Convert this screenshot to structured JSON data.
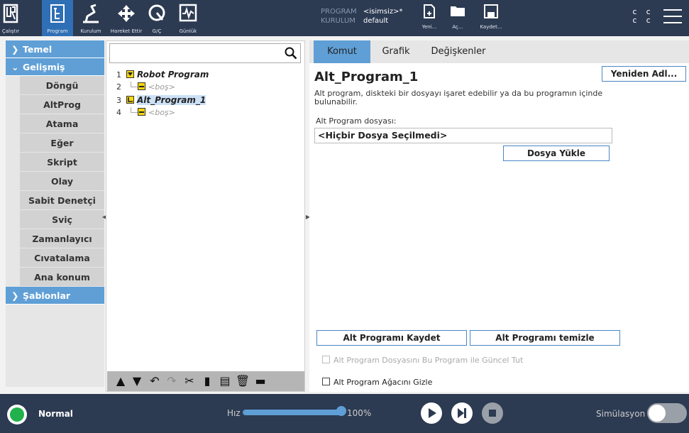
{
  "header": {
    "nav": [
      {
        "key": "run",
        "label": "Çalıştır",
        "icon": "ur-logo-icon"
      },
      {
        "key": "program",
        "label": "Program",
        "icon": "program-icon",
        "active": true
      },
      {
        "key": "installation",
        "label": "Kurulum",
        "icon": "installation-icon"
      },
      {
        "key": "move",
        "label": "Hareket Ettir",
        "icon": "move-icon"
      },
      {
        "key": "io",
        "label": "G/Ç",
        "icon": "io-icon"
      },
      {
        "key": "log",
        "label": "Günlük",
        "icon": "log-icon"
      }
    ],
    "program_label": "PROGRAM",
    "program_value": "<isimsiz>*",
    "installation_label": "KURULUM",
    "installation_value": "default",
    "file_buttons": [
      {
        "label": "Yeni...",
        "icon": "new-file-icon"
      },
      {
        "label": "Aç...",
        "icon": "open-folder-icon"
      },
      {
        "label": "Kaydet...",
        "icon": "save-icon"
      }
    ],
    "cc_top": "c c",
    "cc_bottom": "c c"
  },
  "sidebar": {
    "temel": "Temel",
    "gelismis": "Gelişmiş",
    "items": [
      "Döngü",
      "AltProg",
      "Atama",
      "Eğer",
      "Skript",
      "Olay",
      "Sabit Denetçi",
      "Sviç",
      "Zamanlayıcı",
      "Cıvatalama",
      "Ana konum"
    ],
    "sablonlar": "Şablonlar"
  },
  "tree": {
    "search_placeholder": "",
    "rows": [
      {
        "num": "1",
        "text": "Robot Program"
      },
      {
        "num": "2",
        "text": "<boş>"
      },
      {
        "num": "3",
        "text": "Alt_Program_1"
      },
      {
        "num": "4",
        "text": "<boş>"
      }
    ]
  },
  "tabs": [
    "Komut",
    "Grafik",
    "Değişkenler"
  ],
  "panel": {
    "title": "Alt_Program_1",
    "rename_button": "Yeniden Adl...",
    "description": "Alt program, diskteki bir dosyayı işaret edebilir ya da bu programın içinde bulunabilir.",
    "file_label": "Alt Program dosyası:",
    "file_value": "<Hiçbir Dosya Seçilmedi>",
    "load_button": "Dosya Yükle",
    "save_button": "Alt Programı Kaydet",
    "clear_button": "Alt Programı temizle",
    "keep_updated": "Alt Program Dosyasını Bu Program ile Güncel Tut",
    "hide_tree": "Alt Program Ağacını Gizle"
  },
  "footer": {
    "status": "Normal",
    "speed_label": "Hız",
    "speed_value": "100%",
    "speed_fraction": 1.0,
    "simulation_label": "Simülasyon"
  },
  "colors": {
    "header_bg": "#2c3a52",
    "accent": "#5f9fd6",
    "status_green": "#22b14c"
  }
}
